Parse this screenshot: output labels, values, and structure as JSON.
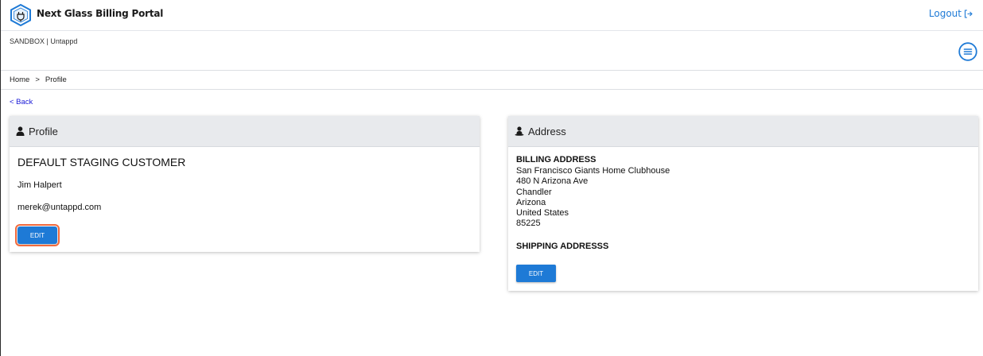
{
  "header": {
    "app_title": "Next Glass Billing Portal",
    "logout_label": "Logout",
    "logo_icon": "hexagon-plug-logo-icon",
    "logout_icon": "logout-arrow-icon",
    "accent_color": "#1e7ad6"
  },
  "env": {
    "label": "SANDBOX | Untappd",
    "menu_icon": "hamburger-circle-icon"
  },
  "breadcrumb": {
    "items": [
      "Home",
      ">",
      "Profile"
    ]
  },
  "back_link": "< Back",
  "profile": {
    "header_label": "Profile",
    "header_icon": "user-icon",
    "customer_name": "DEFAULT STAGING CUSTOMER",
    "contact_name": "Jim Halpert",
    "email": "merek@untappd.com",
    "edit_label": "EDIT"
  },
  "address": {
    "header_label": "Address",
    "header_icon": "user-pin-icon",
    "billing_heading": "BILLING ADDRESS",
    "billing_lines": [
      "San Francisco Giants Home Clubhouse",
      "480 N Arizona Ave",
      "Chandler",
      "Arizona",
      "United States",
      "85225"
    ],
    "shipping_heading": "SHIPPING ADDRESSS",
    "edit_label": "EDIT"
  }
}
